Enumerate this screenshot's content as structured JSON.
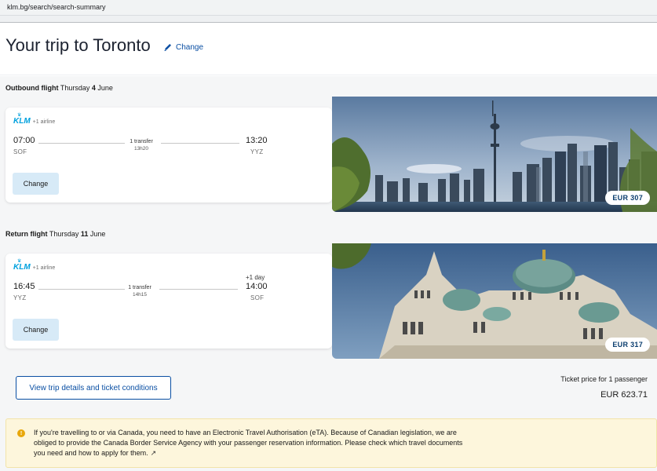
{
  "browser": {
    "url": "klm.bg/search/search-summary"
  },
  "header": {
    "title": "Your trip to Toronto",
    "change_label": "Change"
  },
  "outbound": {
    "label": "Outbound flight",
    "day": "Thursday",
    "date_num": "4",
    "month": "June",
    "airline_logo": "KLM",
    "airline_extra": "+1 airline",
    "depart_time": "07:00",
    "depart_code": "SOF",
    "transfer": "1 transfer",
    "duration": "13h20",
    "arrive_time": "13:20",
    "arrive_code": "YYZ",
    "change_button": "Change",
    "price": "EUR 307",
    "photo": "toronto-skyline"
  },
  "return": {
    "label": "Return flight",
    "day": "Thursday",
    "date_num": "11",
    "month": "June",
    "airline_logo": "KLM",
    "airline_extra": "+1 airline",
    "depart_time": "16:45",
    "depart_code": "YYZ",
    "transfer": "1 transfer",
    "duration": "14h15",
    "plus_day": "+1 day",
    "arrive_time": "14:00",
    "arrive_code": "SOF",
    "change_button": "Change",
    "price": "EUR 317",
    "photo": "sofia-cathedral"
  },
  "summary": {
    "details_button": "View trip details and ticket conditions",
    "ticket_label": "Ticket price for 1 passenger",
    "ticket_price": "EUR 623.71"
  },
  "notice": {
    "icon": "info-icon",
    "text": "If you're travelling to or via Canada, you need to have an Electronic Travel Authorisation (eTA). Because of Canadian legislation, we are obliged to provide the Canada Border Service Agency with your passenger reservation information. Please check which travel documents you need and how to apply for them."
  },
  "colors": {
    "link_blue": "#0a4fa3",
    "klm_blue": "#00a1de",
    "button_bg": "#d7eaf7",
    "notice_bg": "#fdf6dc"
  }
}
